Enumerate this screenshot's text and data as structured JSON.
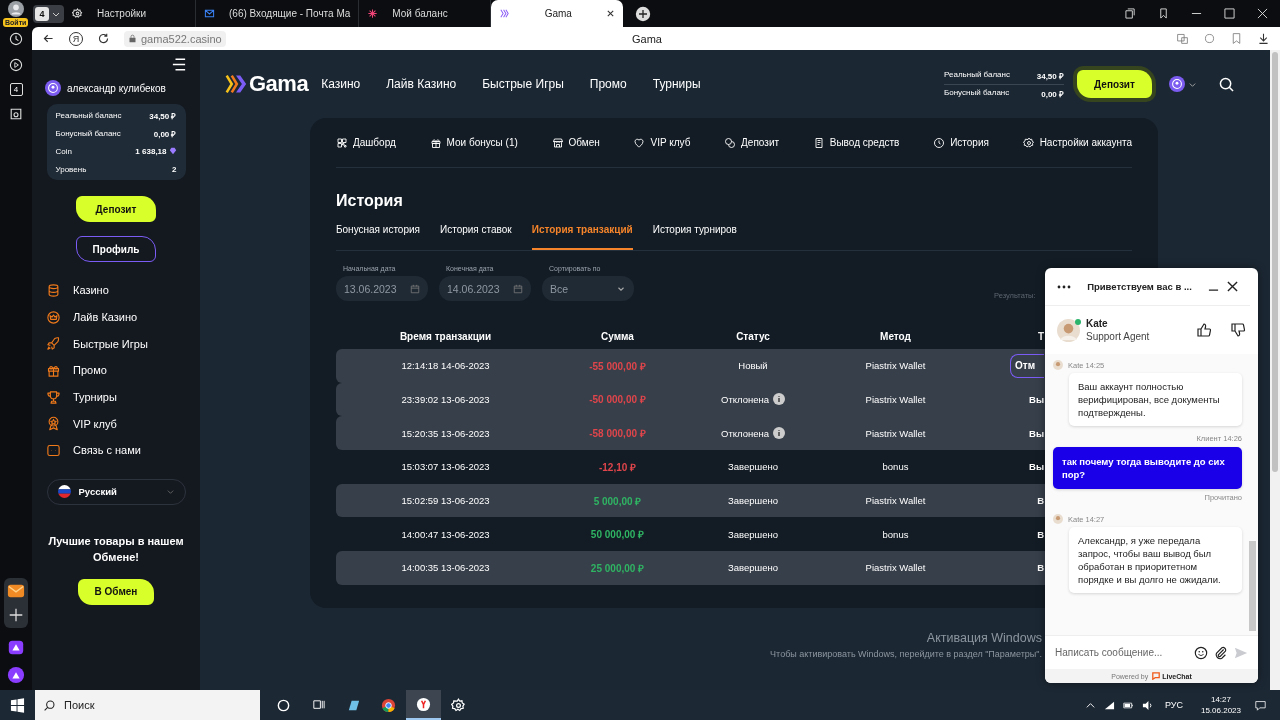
{
  "browser": {
    "profile_badge": "Войти",
    "tab_count": "4",
    "tabs": [
      {
        "title": "Настройки",
        "kind": "gear",
        "selected": false
      },
      {
        "title": "(66) Входящие - Почта Ma",
        "kind": "mail",
        "selected": false
      },
      {
        "title": "Мой баланс",
        "kind": "flower",
        "selected": false
      },
      {
        "title": "Gama",
        "kind": "logo",
        "selected": true
      }
    ],
    "home_button": "Я",
    "url": "gama522.casino",
    "page_title": "Gama",
    "side_badge": "4"
  },
  "sidebar": {
    "user": "александр кулибеков",
    "balances": [
      {
        "label": "Реальный баланс",
        "value": "34,50 ₽",
        "kind": "plain"
      },
      {
        "label": "Бонусный баланс",
        "value": "0,00 ₽",
        "kind": "plain"
      },
      {
        "label": "Coin",
        "value": "1 638,18",
        "kind": "coin"
      },
      {
        "label": "Уровень",
        "value": "2",
        "kind": "plain"
      }
    ],
    "deposit": "Депозит",
    "profile": "Профиль",
    "nav": [
      {
        "label": "Казино",
        "kind": "coins"
      },
      {
        "label": "Лайв Казино",
        "kind": "crown"
      },
      {
        "label": "Быстрые Игры",
        "kind": "rocket"
      },
      {
        "label": "Промо",
        "kind": "gift"
      },
      {
        "label": "Турниры",
        "kind": "trophy"
      },
      {
        "label": "VIP клуб",
        "kind": "medal"
      },
      {
        "label": "Связь с нами",
        "kind": "chat"
      }
    ],
    "language": "Русский",
    "promo_text": "Лучшие товары в нашем Обмене!",
    "promo_button": "В Обмен"
  },
  "header": {
    "logo": "Gama",
    "nav": [
      "Казино",
      "Лайв Казино",
      "Быстрые Игры",
      "Промо",
      "Турниры"
    ],
    "balances": [
      {
        "label": "Реальный баланс",
        "value": "34,50 ₽"
      },
      {
        "label": "Бонусный баланс",
        "value": "0,00 ₽"
      }
    ],
    "deposit": "Депозит"
  },
  "account_tabs": [
    {
      "label": "Дашборд",
      "kind": "grid"
    },
    {
      "label": "Мои бонусы (1)",
      "kind": "gift"
    },
    {
      "label": "Обмен",
      "kind": "store"
    },
    {
      "label": "VIP клуб",
      "kind": "heart"
    },
    {
      "label": "Депозит",
      "kind": "coinswap"
    },
    {
      "label": "Вывод средств",
      "kind": "document"
    },
    {
      "label": "История",
      "kind": "clock"
    },
    {
      "label": "Настройки аккаунта",
      "kind": "gear"
    }
  ],
  "history": {
    "title": "История",
    "tabs": [
      {
        "label": "Бонусная история",
        "selected": false
      },
      {
        "label": "История ставок",
        "selected": false
      },
      {
        "label": "История транзакций",
        "selected": true
      },
      {
        "label": "История турниров",
        "selected": false
      }
    ],
    "filters": [
      {
        "label": "Начальная дата",
        "value": "13.06.2023",
        "kind": "date"
      },
      {
        "label": "Конечная дата",
        "value": "14.06.2023",
        "kind": "date"
      },
      {
        "label": "Сортировать по",
        "value": "Все",
        "kind": "select"
      }
    ],
    "results_label": "Результаты:"
  },
  "table": {
    "columns": [
      "Время транзакции",
      "Сумма",
      "Статус",
      "Метод",
      "Т"
    ],
    "rows": [
      {
        "time": "12:14:18 14-06-2023",
        "amount": {
          "text": "-55 000,00 ₽",
          "color": "#e0454b"
        },
        "status": "Новый",
        "info": false,
        "method": "Piastrix Wallet",
        "action": {
          "text": "Отм",
          "kind": "button"
        },
        "shaded": true
      },
      {
        "time": "23:39:02 13-06-2023",
        "amount": {
          "text": "-50 000,00 ₽",
          "color": "#e0454b"
        },
        "status": "Отклонена",
        "info": true,
        "method": "Piastrix Wallet",
        "action": {
          "text": "Вы",
          "kind": "text"
        },
        "shaded": true
      },
      {
        "time": "15:20:35 13-06-2023",
        "amount": {
          "text": "-58 000,00 ₽",
          "color": "#e0454b"
        },
        "status": "Отклонена",
        "info": true,
        "method": "Piastrix Wallet",
        "action": {
          "text": "Вы",
          "kind": "text"
        },
        "shaded": true
      },
      {
        "time": "15:03:07 13-06-2023",
        "amount": {
          "text": "-12,10 ₽",
          "color": "#e0454b"
        },
        "status": "Завершено",
        "info": false,
        "method": "bonus",
        "action": {
          "text": "Вы",
          "kind": "text"
        },
        "shaded": false
      },
      {
        "time": "15:02:59 13-06-2023",
        "amount": {
          "text": "5 000,00 ₽",
          "color": "#2fb463"
        },
        "status": "Завершено",
        "info": false,
        "method": "Piastrix Wallet",
        "action": {
          "text": "В",
          "kind": "text"
        },
        "shaded": true
      },
      {
        "time": "14:00:47 13-06-2023",
        "amount": {
          "text": "50 000,00 ₽",
          "color": "#2fb463"
        },
        "status": "Завершено",
        "info": false,
        "method": "bonus",
        "action": {
          "text": "В",
          "kind": "text"
        },
        "shaded": false
      },
      {
        "time": "14:00:35 13-06-2023",
        "amount": {
          "text": "25 000,00 ₽",
          "color": "#2fb463"
        },
        "status": "Завершено",
        "info": false,
        "method": "Piastrix Wallet",
        "action": {
          "text": "В",
          "kind": "text"
        },
        "shaded": true
      }
    ]
  },
  "chat": {
    "title": "Приветствуем вас в ...",
    "agent": {
      "name": "Kate",
      "role": "Support Agent",
      "online": true
    },
    "messages": [
      {
        "kind": "agent",
        "meta": "Kate 14:25",
        "text": "Ваш аккаунт полностью верифицирован, все документы подтверждены."
      },
      {
        "kind": "client",
        "meta": "Клиент 14:26",
        "text": "так почему тогда выводите до сих пор?",
        "status": "Прочитано"
      },
      {
        "kind": "agent",
        "meta": "Kate 14:27",
        "text": "Александр, я уже передала запрос, чтобы ваш вывод был обработан в приоритетном порядке и вы долго не ожидали."
      }
    ],
    "input_placeholder": "Написать сообщение...",
    "powered_by": "Powered by",
    "brand": "LiveChat"
  },
  "activation": {
    "title": "Активация Windows",
    "text": "Чтобы активировать Windows, перейдите в раздел \"Параметры\"."
  },
  "taskbar": {
    "search_placeholder": "Поиск",
    "language": "РУС",
    "time": "14:27",
    "date": "15.06.2023"
  }
}
